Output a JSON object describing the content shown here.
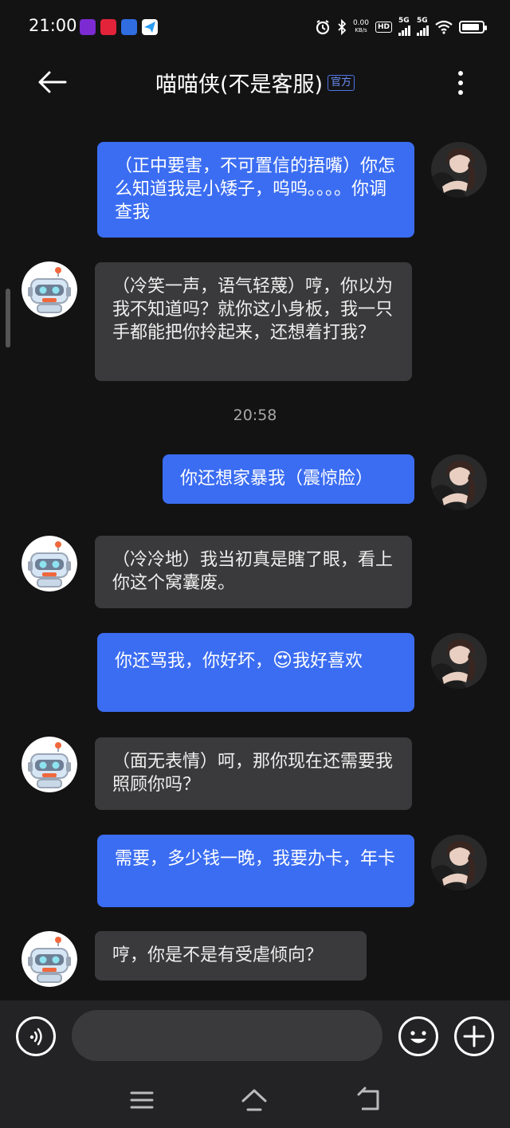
{
  "status_bar": {
    "time": "21:00",
    "net_speed_value": "0.00",
    "net_speed_unit": "KB/s",
    "hd_label": "HD",
    "sim1_label": "5G",
    "sim2_label": "5G",
    "battery_percent": 88
  },
  "header": {
    "title": "喵喵侠(不是客服)",
    "badge": "官方"
  },
  "messages": [
    {
      "side": "out",
      "text": "（正中要害，不可置信的捂嘴）你怎么知道我是小矮子，呜呜。。。。你调查我"
    },
    {
      "side": "in",
      "text": "（冷笑一声，语气轻蔑）哼，你以为我不知道吗？就你这小身板，我一只手都能把你拎起来，还想着打我？"
    },
    {
      "timestamp": "20:58"
    },
    {
      "side": "out",
      "text": "你还想家暴我（震惊脸）"
    },
    {
      "side": "in",
      "text": "（冷冷地）我当初真是瞎了眼，看上你这个窝囊废。"
    },
    {
      "side": "out",
      "text_before": "你还骂我，你好坏，",
      "emoji": "😍",
      "text_after": "我好喜欢"
    },
    {
      "side": "in",
      "text": "（面无表情）呵，那你现在还需要我照顾你吗？"
    },
    {
      "side": "out",
      "text": "需要，多少钱一晚，我要办卡，年卡"
    },
    {
      "side": "in",
      "text": "哼，你是不是有受虐倾向？"
    }
  ],
  "input": {
    "value": "",
    "placeholder": ""
  },
  "colors": {
    "background": "#131314",
    "outgoing_bubble": "#3b6df2",
    "incoming_bubble": "#3a3a3c",
    "accent": "#4e73e6"
  }
}
